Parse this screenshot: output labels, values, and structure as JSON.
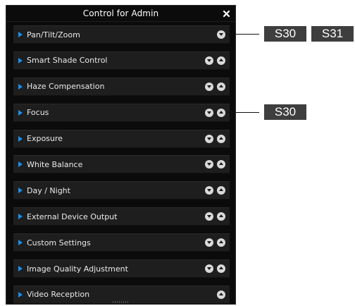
{
  "window": {
    "title": "Control for Admin",
    "close_icon": "close-icon"
  },
  "rows": [
    {
      "label": "Pan/Tilt/Zoom",
      "buttons": [
        "down"
      ]
    },
    {
      "label": "Smart Shade Control",
      "buttons": [
        "down",
        "up"
      ]
    },
    {
      "label": "Haze Compensation",
      "buttons": [
        "down",
        "up"
      ]
    },
    {
      "label": "Focus",
      "buttons": [
        "down",
        "up"
      ]
    },
    {
      "label": "Exposure",
      "buttons": [
        "down",
        "up"
      ]
    },
    {
      "label": "White Balance",
      "buttons": [
        "down",
        "up"
      ]
    },
    {
      "label": "Day / Night",
      "buttons": [
        "down",
        "up"
      ]
    },
    {
      "label": "External Device Output",
      "buttons": [
        "down",
        "up"
      ]
    },
    {
      "label": "Custom Settings",
      "buttons": [
        "down",
        "up"
      ]
    },
    {
      "label": "Image Quality Adjustment",
      "buttons": [
        "down",
        "up"
      ]
    },
    {
      "label": "Video Reception",
      "buttons": [
        "up"
      ]
    }
  ],
  "callouts": [
    {
      "row": "Pan/Tilt/Zoom",
      "badges": [
        "S30",
        "S31"
      ]
    },
    {
      "row": "Focus",
      "badges": [
        "S30"
      ]
    }
  ],
  "colors": {
    "panel_bg": "#0b0b0b",
    "row_bg": "#1e1e1e",
    "arrow_accent": "#1e8ee8",
    "badge_bg": "#3e3e3e"
  }
}
